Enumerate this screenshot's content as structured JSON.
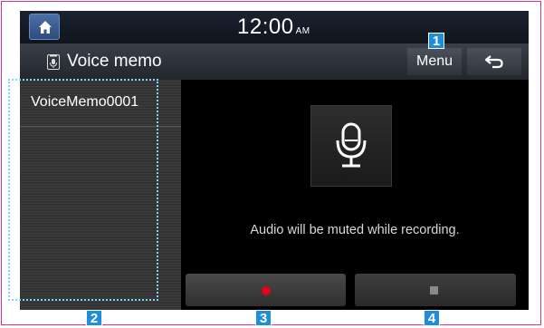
{
  "status": {
    "time": "12:00",
    "ampm": "AM",
    "home_icon": "home-icon"
  },
  "title": {
    "text": "Voice memo",
    "icon": "voice-memo-icon"
  },
  "toolbar": {
    "menu_label": "Menu",
    "back_icon": "back-arrow-icon"
  },
  "list": {
    "items": [
      {
        "label": "VoiceMemo0001"
      }
    ]
  },
  "main": {
    "mic_icon": "microphone-icon",
    "message": "Audio will be muted while recording."
  },
  "controls": {
    "record_icon": "record-icon",
    "stop_icon": "stop-icon"
  },
  "callouts": [
    "1",
    "2",
    "3",
    "4"
  ],
  "colors": {
    "record": "#e60018",
    "callout": "#1f8ed8",
    "frame": "#d7338a"
  }
}
